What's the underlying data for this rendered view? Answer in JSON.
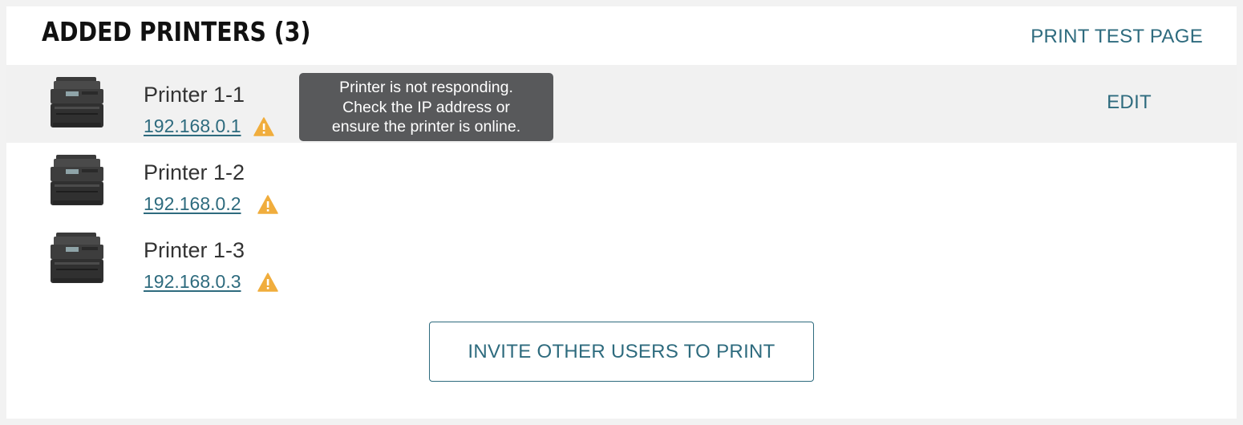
{
  "header": {
    "title": "ADDED PRINTERS (3)",
    "print_test_page": "PRINT TEST PAGE"
  },
  "printers": [
    {
      "name": "Printer 1-1",
      "ip": "192.168.0.1",
      "status_icon": "warning-icon",
      "edit_label": "EDIT"
    },
    {
      "name": "Printer 1-2",
      "ip": "192.168.0.2",
      "status_icon": "warning-icon"
    },
    {
      "name": "Printer 1-3",
      "ip": "192.168.0.3",
      "status_icon": "warning-icon"
    }
  ],
  "tooltip": {
    "lines": [
      "Printer is not responding.",
      "Check the IP address or",
      "ensure the printer is online."
    ]
  },
  "invite_button": "INVITE OTHER USERS TO PRINT",
  "colors": {
    "accent": "#2e6b7e",
    "warning": "#f0ad3d",
    "tooltip_bg": "#58595b",
    "row_highlight": "#f1f1f1"
  }
}
